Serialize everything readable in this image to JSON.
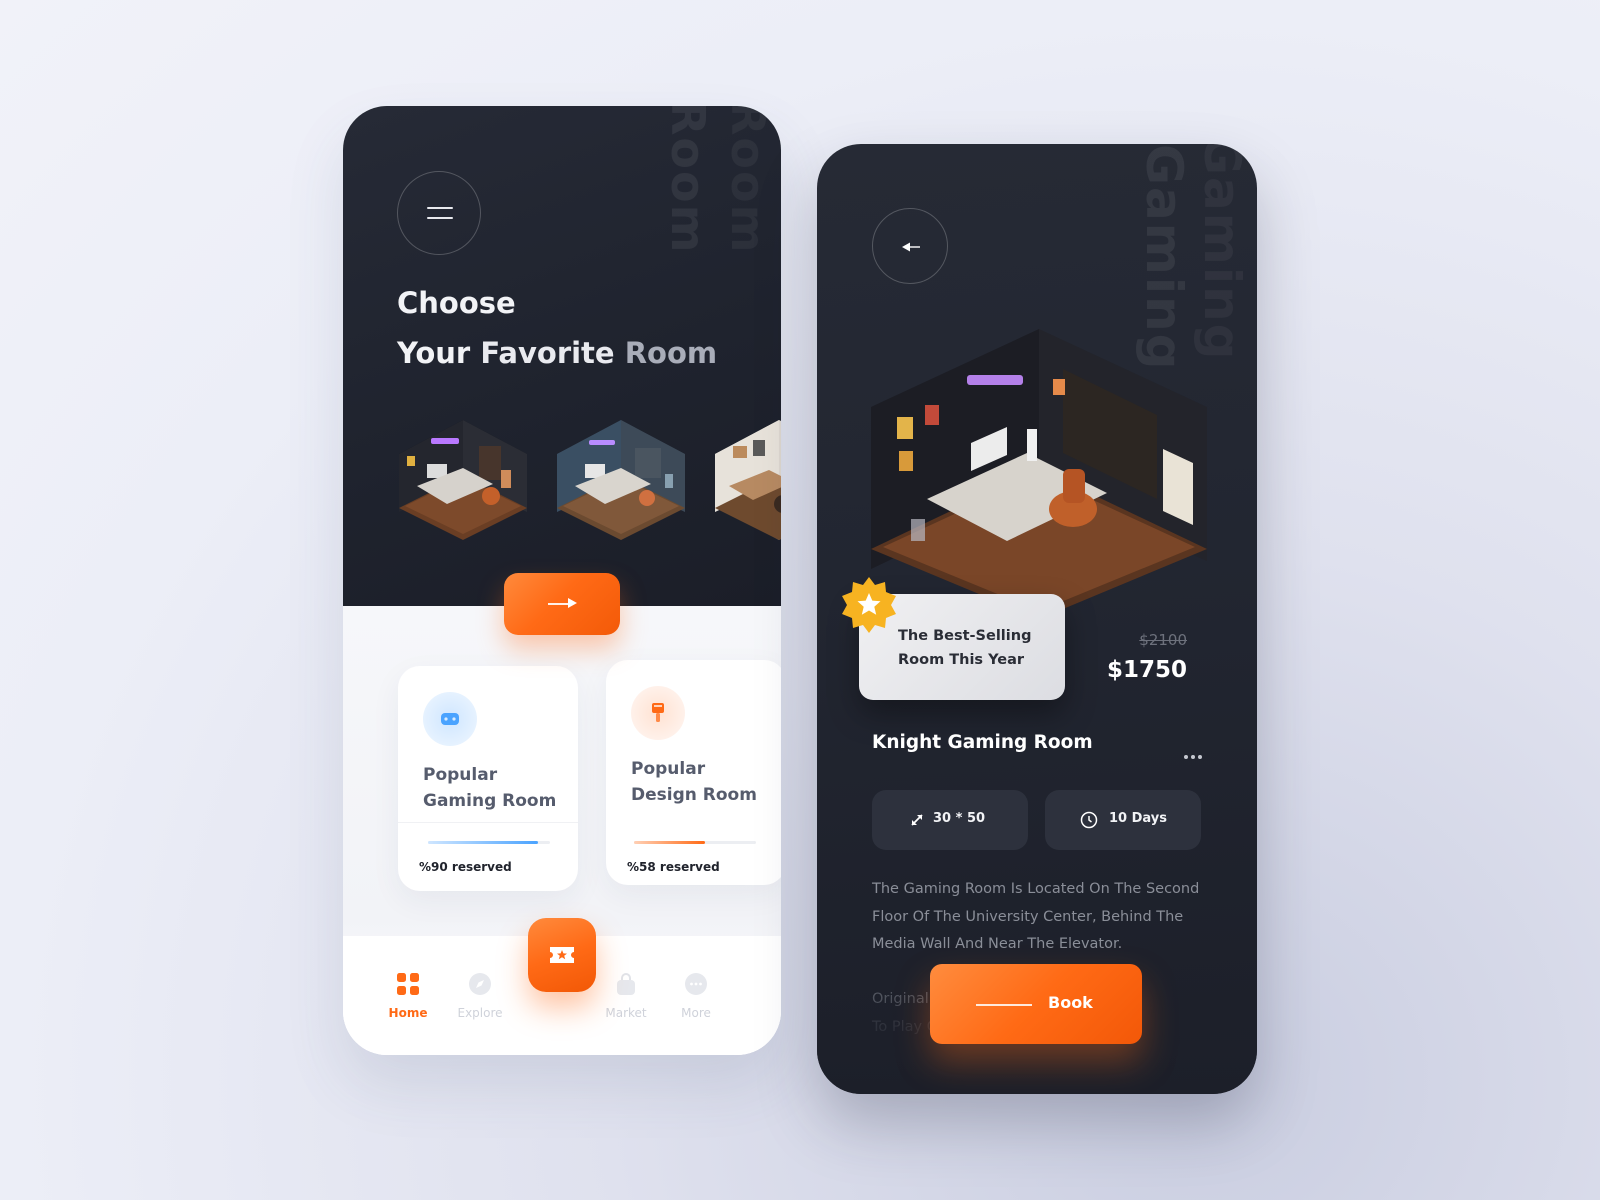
{
  "left_screen": {
    "ghost_text": [
      "Room",
      "Room"
    ],
    "menu_icon": "hamburger-menu-icon",
    "headline": {
      "line1": "Choose",
      "line2_a": "Your ",
      "line2_b": "Favorite ",
      "line2_c": "Room"
    },
    "room_thumbnails": [
      {
        "name": "gaming-room-thumbnail",
        "theme": "gaming"
      },
      {
        "name": "design-room-thumbnail",
        "theme": "design"
      },
      {
        "name": "office-room-thumbnail",
        "theme": "office"
      }
    ],
    "next_button_icon": "arrow-right-icon",
    "categories": [
      {
        "title_line1": "Popular",
        "title_line2": "Gaming Room",
        "reserved_label": "%90 reserved",
        "reserved_fraction": 0.9,
        "icon": "gamepad-icon",
        "accent": "#4aa3ff"
      },
      {
        "title_line1": "Popular",
        "title_line2": "Design Room",
        "reserved_label": "%58 reserved",
        "reserved_fraction": 0.58,
        "icon": "paint-brush-icon",
        "accent": "#ff6a16"
      }
    ],
    "nav": {
      "items": [
        {
          "label": "Home",
          "icon": "grid-icon",
          "active": true
        },
        {
          "label": "Explore",
          "icon": "compass-icon",
          "active": false
        },
        {
          "label": "Market",
          "icon": "shopping-bag-icon",
          "active": false
        },
        {
          "label": "More",
          "icon": "more-icon",
          "active": false
        }
      ],
      "center_button_icon": "ticket-icon"
    }
  },
  "right_screen": {
    "ghost_text": [
      "Gaming",
      "Gaming"
    ],
    "back_icon": "arrow-left-icon",
    "badge": {
      "line1": "The Best-Selling",
      "line2": "Room This Year",
      "icon": "star-badge-icon"
    },
    "price": {
      "old": "$2100",
      "current": "$1750"
    },
    "room_name": "Knight Gaming Room",
    "more_icon": "more-horizontal-icon",
    "specs": [
      {
        "icon": "resize-icon",
        "label": "30 * 50"
      },
      {
        "icon": "clock-icon",
        "label": "10 Days"
      }
    ],
    "description": [
      "The Gaming Room Is Located On The Second",
      "Floor Of The University Center, Behind The",
      "Media Wall And Near The Elevator.",
      "",
      "Originally Designed For Students",
      "To Play Games, The"
    ],
    "book_label": "Book",
    "colors": {
      "accent": "#ff6a16",
      "dark": "#1f232e",
      "gold": "#f7b321"
    }
  }
}
